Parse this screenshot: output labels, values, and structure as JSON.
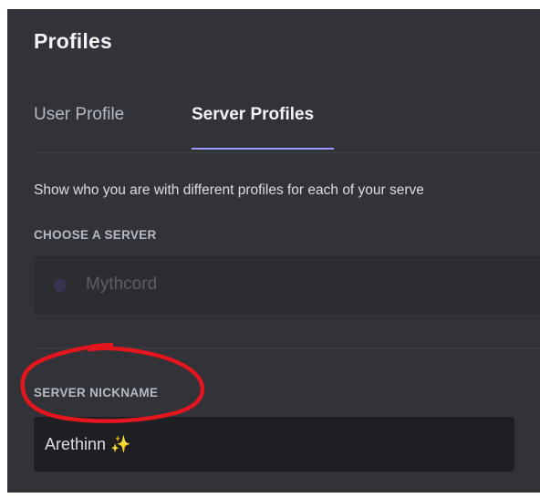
{
  "page": {
    "title": "Profiles"
  },
  "tabs": [
    {
      "label": "User Profile",
      "active": false
    },
    {
      "label": "Server Profiles",
      "active": true
    }
  ],
  "description": "Show who you are with different profiles for each of your serve",
  "server_select": {
    "label": "CHOOSE A SERVER",
    "selected": "Mythcord",
    "icon": "server-icon"
  },
  "nickname": {
    "label": "SERVER NICKNAME",
    "value": "Arethinn ✨"
  },
  "annotation": {
    "shape": "hand-drawn circle",
    "color": "#e3161e",
    "target": "SERVER NICKNAME"
  },
  "colors": {
    "background": "#313338",
    "accent": "#949cf7",
    "input_bg": "#1e1f22",
    "annotation_red": "#e3161e"
  }
}
